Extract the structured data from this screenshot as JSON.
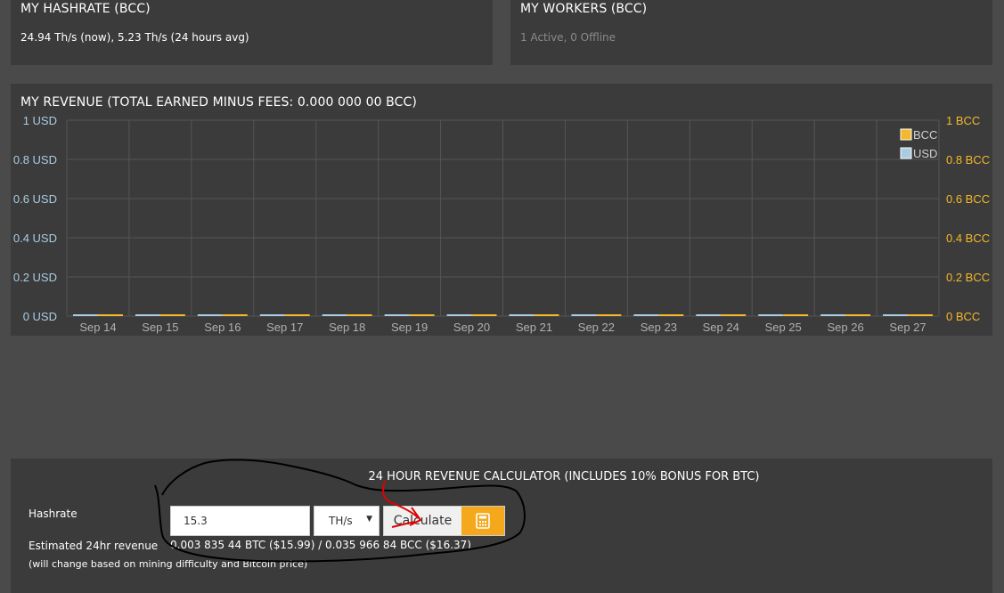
{
  "hashrate_panel": {
    "title": "MY HASHRATE (BCC)",
    "value": "24.94 Th/s (now), 5.23 Th/s (24 hours avg)"
  },
  "workers_panel": {
    "title": "MY WORKERS (BCC)",
    "value": "1 Active, 0 Offline"
  },
  "revenue_panel": {
    "title": "MY REVENUE (TOTAL EARNED MINUS FEES: 0.000 000 00 BCC)"
  },
  "chart_data": {
    "type": "bar",
    "title": "MY REVENUE (TOTAL EARNED MINUS FEES: 0.000 000 00 BCC)",
    "categories": [
      "Sep 14",
      "Sep 15",
      "Sep 16",
      "Sep 17",
      "Sep 18",
      "Sep 19",
      "Sep 20",
      "Sep 21",
      "Sep 22",
      "Sep 23",
      "Sep 24",
      "Sep 25",
      "Sep 26",
      "Sep 27"
    ],
    "series": [
      {
        "name": "BCC",
        "color": "#f5b829",
        "axis": "right",
        "values": [
          0,
          0,
          0,
          0,
          0,
          0,
          0,
          0,
          0,
          0,
          0,
          0,
          0,
          0
        ]
      },
      {
        "name": "USD",
        "color": "#a9cce3",
        "axis": "left",
        "values": [
          0,
          0,
          0,
          0,
          0,
          0,
          0,
          0,
          0,
          0,
          0,
          0,
          0,
          0
        ]
      }
    ],
    "left_axis": {
      "ticks": [
        "0 USD",
        "0.2 USD",
        "0.4 USD",
        "0.6 USD",
        "0.8 USD",
        "1 USD"
      ],
      "ylim": [
        0,
        1
      ],
      "color": "#a9cce3"
    },
    "right_axis": {
      "ticks": [
        "0 BCC",
        "0.2 BCC",
        "0.4 BCC",
        "0.6 BCC",
        "0.8 BCC",
        "1 BCC"
      ],
      "ylim": [
        0,
        1
      ],
      "color": "#f5b829"
    },
    "grid": true,
    "legend_position": "top-right"
  },
  "calculator": {
    "title": "24 HOUR REVENUE CALCULATOR (INCLUDES 10% BONUS FOR BTC)",
    "hashrate_label": "Hashrate",
    "hashrate_value": "15.3",
    "unit_value": "TH/s",
    "calculate_label": "Calculate",
    "estimate_label": "Estimated 24hr revenue",
    "estimate_note": "(will change based on mining difficulty and Bitcoin price)",
    "estimate_value": "0.003 835 44 BTC ($15.99) / 0.035 966 84 BCC ($16.37)"
  },
  "icons": {
    "calculator": "calculator-icon",
    "dropdown": "chevron-down-icon"
  }
}
